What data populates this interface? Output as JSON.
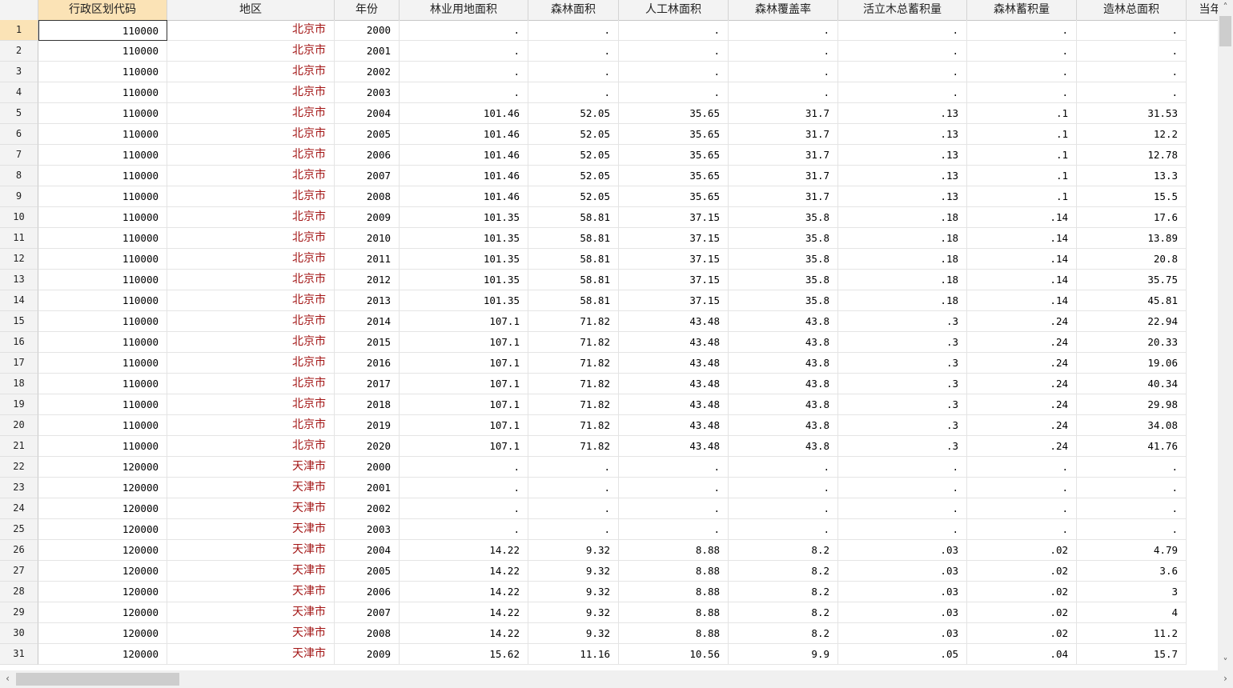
{
  "columns": [
    "行政区划代码",
    "地区",
    "年份",
    "林业用地面积",
    "森林面积",
    "人工林面积",
    "森林覆盖率",
    "活立木总蓄积量",
    "森林蓄积量",
    "造林总面积",
    "当年"
  ],
  "icons": {
    "scroll_up": "chevron-up-icon",
    "scroll_down": "chevron-down-icon",
    "scroll_left": "chevron-left-icon",
    "scroll_right": "chevron-right-icon"
  },
  "rows": [
    [
      "1",
      "110000",
      "北京市",
      "2000",
      ".",
      ".",
      ".",
      ".",
      ".",
      ".",
      "."
    ],
    [
      "2",
      "110000",
      "北京市",
      "2001",
      ".",
      ".",
      ".",
      ".",
      ".",
      ".",
      "."
    ],
    [
      "3",
      "110000",
      "北京市",
      "2002",
      ".",
      ".",
      ".",
      ".",
      ".",
      ".",
      "."
    ],
    [
      "4",
      "110000",
      "北京市",
      "2003",
      ".",
      ".",
      ".",
      ".",
      ".",
      ".",
      "."
    ],
    [
      "5",
      "110000",
      "北京市",
      "2004",
      "101.46",
      "52.05",
      "35.65",
      "31.7",
      ".13",
      ".1",
      "31.53"
    ],
    [
      "6",
      "110000",
      "北京市",
      "2005",
      "101.46",
      "52.05",
      "35.65",
      "31.7",
      ".13",
      ".1",
      "12.2"
    ],
    [
      "7",
      "110000",
      "北京市",
      "2006",
      "101.46",
      "52.05",
      "35.65",
      "31.7",
      ".13",
      ".1",
      "12.78"
    ],
    [
      "8",
      "110000",
      "北京市",
      "2007",
      "101.46",
      "52.05",
      "35.65",
      "31.7",
      ".13",
      ".1",
      "13.3"
    ],
    [
      "9",
      "110000",
      "北京市",
      "2008",
      "101.46",
      "52.05",
      "35.65",
      "31.7",
      ".13",
      ".1",
      "15.5"
    ],
    [
      "10",
      "110000",
      "北京市",
      "2009",
      "101.35",
      "58.81",
      "37.15",
      "35.8",
      ".18",
      ".14",
      "17.6"
    ],
    [
      "11",
      "110000",
      "北京市",
      "2010",
      "101.35",
      "58.81",
      "37.15",
      "35.8",
      ".18",
      ".14",
      "13.89"
    ],
    [
      "12",
      "110000",
      "北京市",
      "2011",
      "101.35",
      "58.81",
      "37.15",
      "35.8",
      ".18",
      ".14",
      "20.8"
    ],
    [
      "13",
      "110000",
      "北京市",
      "2012",
      "101.35",
      "58.81",
      "37.15",
      "35.8",
      ".18",
      ".14",
      "35.75"
    ],
    [
      "14",
      "110000",
      "北京市",
      "2013",
      "101.35",
      "58.81",
      "37.15",
      "35.8",
      ".18",
      ".14",
      "45.81"
    ],
    [
      "15",
      "110000",
      "北京市",
      "2014",
      "107.1",
      "71.82",
      "43.48",
      "43.8",
      ".3",
      ".24",
      "22.94"
    ],
    [
      "16",
      "110000",
      "北京市",
      "2015",
      "107.1",
      "71.82",
      "43.48",
      "43.8",
      ".3",
      ".24",
      "20.33"
    ],
    [
      "17",
      "110000",
      "北京市",
      "2016",
      "107.1",
      "71.82",
      "43.48",
      "43.8",
      ".3",
      ".24",
      "19.06"
    ],
    [
      "18",
      "110000",
      "北京市",
      "2017",
      "107.1",
      "71.82",
      "43.48",
      "43.8",
      ".3",
      ".24",
      "40.34"
    ],
    [
      "19",
      "110000",
      "北京市",
      "2018",
      "107.1",
      "71.82",
      "43.48",
      "43.8",
      ".3",
      ".24",
      "29.98"
    ],
    [
      "20",
      "110000",
      "北京市",
      "2019",
      "107.1",
      "71.82",
      "43.48",
      "43.8",
      ".3",
      ".24",
      "34.08"
    ],
    [
      "21",
      "110000",
      "北京市",
      "2020",
      "107.1",
      "71.82",
      "43.48",
      "43.8",
      ".3",
      ".24",
      "41.76"
    ],
    [
      "22",
      "120000",
      "天津市",
      "2000",
      ".",
      ".",
      ".",
      ".",
      ".",
      ".",
      "."
    ],
    [
      "23",
      "120000",
      "天津市",
      "2001",
      ".",
      ".",
      ".",
      ".",
      ".",
      ".",
      "."
    ],
    [
      "24",
      "120000",
      "天津市",
      "2002",
      ".",
      ".",
      ".",
      ".",
      ".",
      ".",
      "."
    ],
    [
      "25",
      "120000",
      "天津市",
      "2003",
      ".",
      ".",
      ".",
      ".",
      ".",
      ".",
      "."
    ],
    [
      "26",
      "120000",
      "天津市",
      "2004",
      "14.22",
      "9.32",
      "8.88",
      "8.2",
      ".03",
      ".02",
      "4.79"
    ],
    [
      "27",
      "120000",
      "天津市",
      "2005",
      "14.22",
      "9.32",
      "8.88",
      "8.2",
      ".03",
      ".02",
      "3.6"
    ],
    [
      "28",
      "120000",
      "天津市",
      "2006",
      "14.22",
      "9.32",
      "8.88",
      "8.2",
      ".03",
      ".02",
      "3"
    ],
    [
      "29",
      "120000",
      "天津市",
      "2007",
      "14.22",
      "9.32",
      "8.88",
      "8.2",
      ".03",
      ".02",
      "4"
    ],
    [
      "30",
      "120000",
      "天津市",
      "2008",
      "14.22",
      "9.32",
      "8.88",
      "8.2",
      ".03",
      ".02",
      "11.2"
    ],
    [
      "31",
      "120000",
      "天津市",
      "2009",
      "15.62",
      "11.16",
      "10.56",
      "9.9",
      ".05",
      ".04",
      "15.7"
    ]
  ]
}
